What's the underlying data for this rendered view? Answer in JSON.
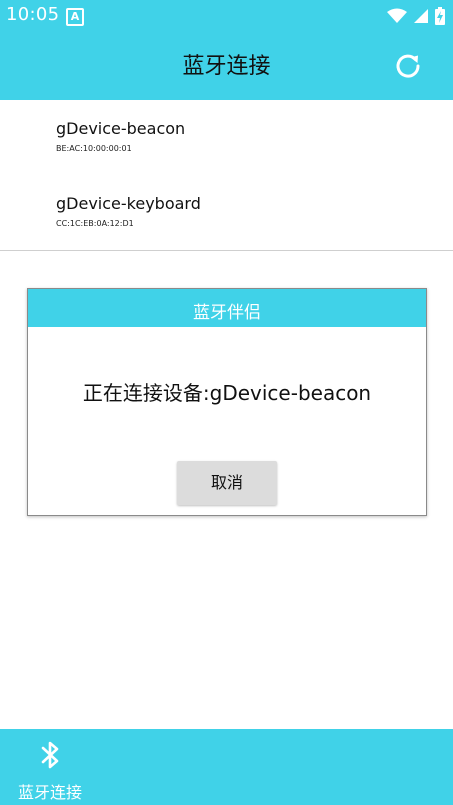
{
  "status_bar": {
    "time": "10:05",
    "notification_icon": "A",
    "icons": [
      "wifi-icon",
      "signal-icon",
      "battery-charging-icon"
    ]
  },
  "app_bar": {
    "title": "蓝牙连接",
    "action_icon": "refresh-icon"
  },
  "devices": [
    {
      "name": "gDevice-beacon",
      "mac": "BE:AC:10:00:00:01"
    },
    {
      "name": "gDevice-keyboard",
      "mac": "CC:1C:EB:0A:12:D1"
    }
  ],
  "dialog": {
    "title": "蓝牙伴侣",
    "message": "正在连接设备:gDevice-beacon",
    "cancel_label": "取消"
  },
  "bottom_nav": {
    "items": [
      {
        "label": "蓝牙连接",
        "icon": "bluetooth-icon"
      }
    ]
  },
  "colors": {
    "accent": "#40d2e8",
    "button": "#dcdcdc"
  }
}
